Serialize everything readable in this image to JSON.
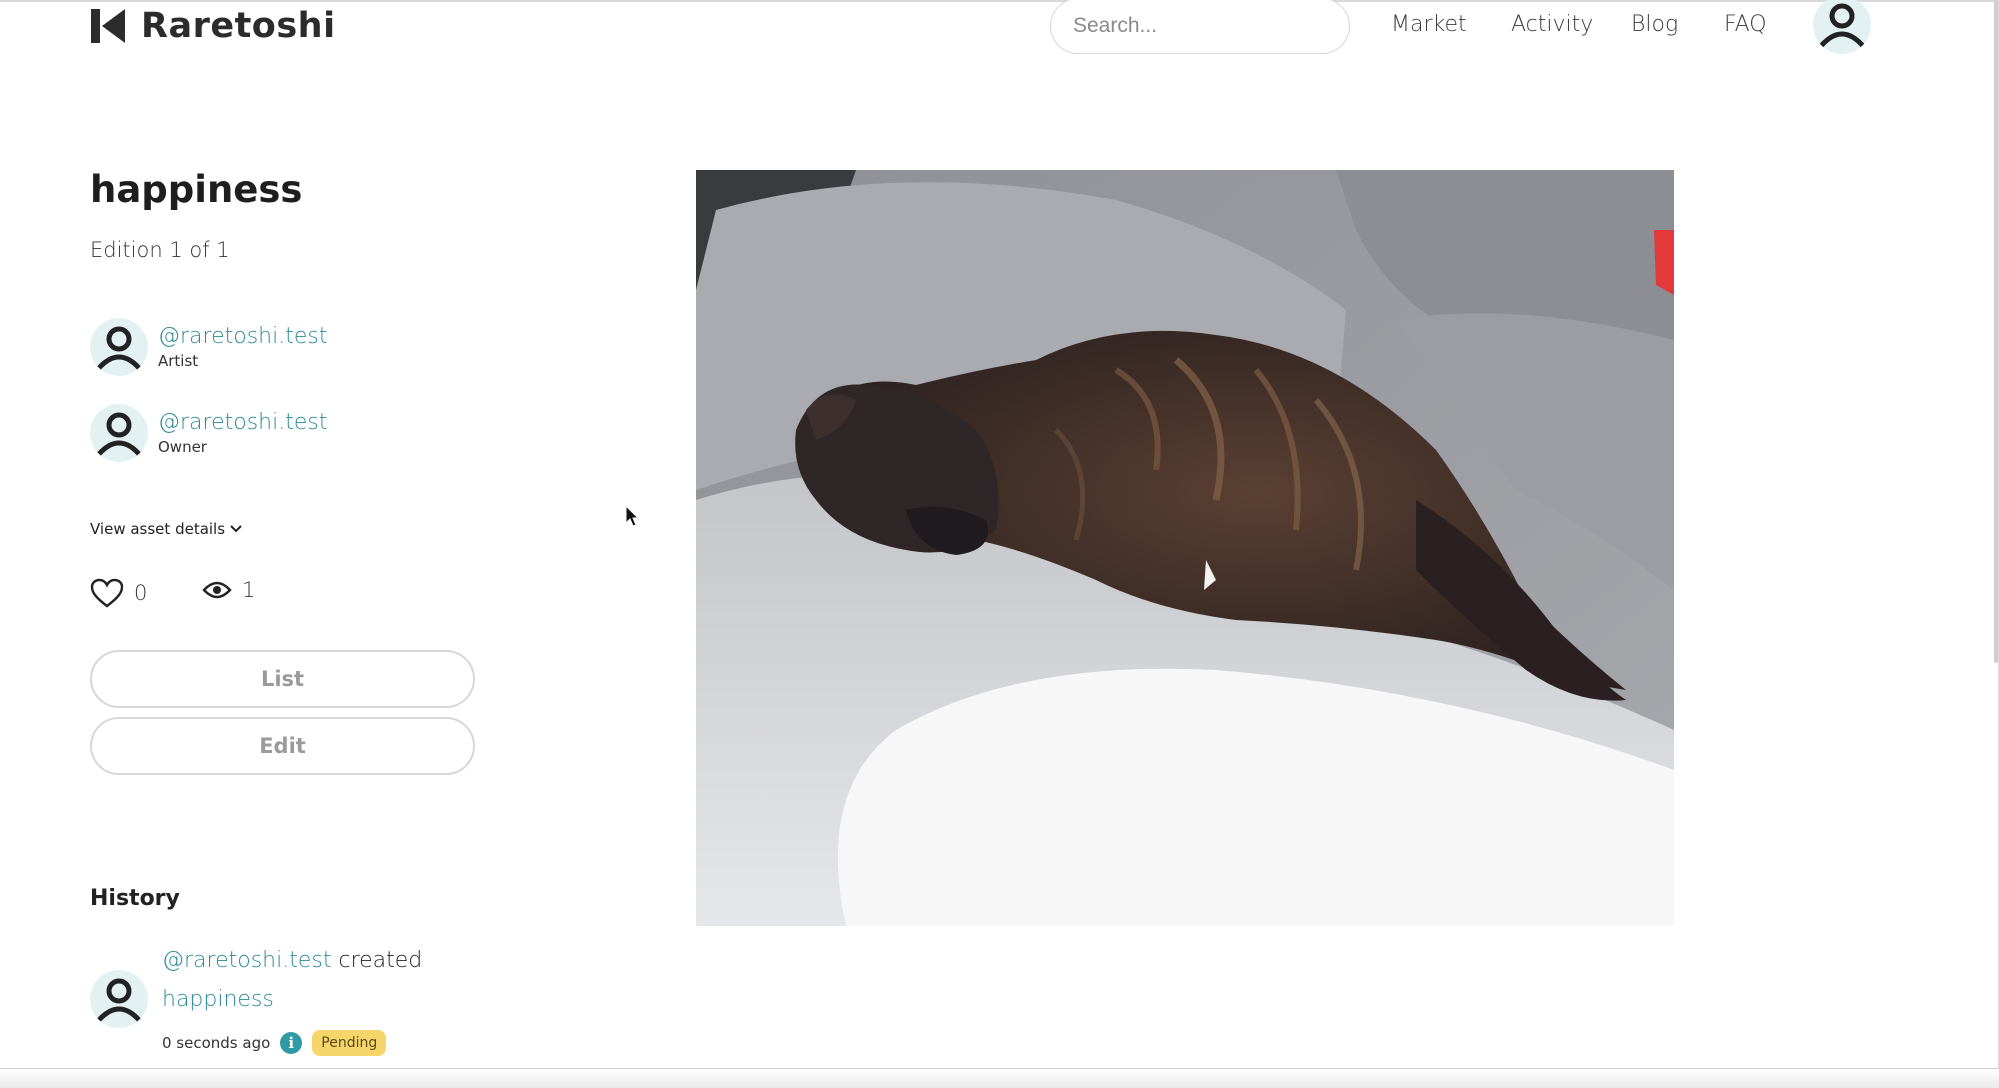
{
  "header": {
    "brand": "Raretoshi",
    "search_placeholder": "Search...",
    "nav": [
      "Market",
      "Activity",
      "Blog",
      "FAQ"
    ]
  },
  "asset": {
    "title": "happiness",
    "edition": "Edition 1 of 1",
    "artist": {
      "handle": "@raretoshi.test",
      "role": "Artist"
    },
    "owner": {
      "handle": "@raretoshi.test",
      "role": "Owner"
    },
    "details_toggle": "View asset details",
    "likes": "0",
    "views": "1"
  },
  "actions": {
    "list_label": "List",
    "edit_label": "Edit"
  },
  "history": {
    "title": "History",
    "events": [
      {
        "user": "@raretoshi.test",
        "verb": "created",
        "asset": "happiness",
        "time": "0 seconds ago",
        "status": "Pending"
      }
    ]
  },
  "colors": {
    "link": "#2b8a96",
    "badge": "#f6d56b",
    "info": "#2f9aa6"
  }
}
